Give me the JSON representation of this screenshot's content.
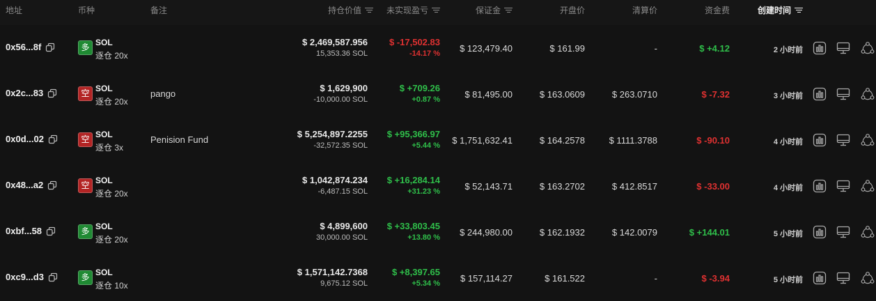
{
  "headers": {
    "address": "地址",
    "coin": "币种",
    "note": "备注",
    "position_value": "持仓价值",
    "unrealized_pnl": "未实现盈亏",
    "margin": "保证金",
    "entry_price": "开盘价",
    "liq_price": "清算价",
    "funding": "资金费",
    "created": "创建时间"
  },
  "colors": {
    "long": "#1f8a33",
    "short": "#b32424",
    "profit": "#2fbf4a",
    "loss": "#e03131"
  },
  "icons": [
    "copy-icon",
    "chart-bars-icon",
    "monitor-icon",
    "share-nodes-icon"
  ],
  "rows": [
    {
      "address": "0x56...8f",
      "side": "多",
      "side_type": "long",
      "coin": "SOL",
      "leverage": "逐仓 20x",
      "note": "",
      "value": "$ 2,469,587.956",
      "size": "15,353.36 SOL",
      "pnl": "$ -17,502.83",
      "pnl_pct": "-14.17 %",
      "pnl_dir": "loss",
      "margin": "$ 123,479.40",
      "entry": "$ 161.99",
      "liq": "-",
      "funding": "$ +4.12",
      "funding_dir": "profit",
      "created": "2 小时前"
    },
    {
      "address": "0x2c...83",
      "side": "空",
      "side_type": "short",
      "coin": "SOL",
      "leverage": "逐仓 20x",
      "note": "pango",
      "value": "$ 1,629,900",
      "size": "-10,000.00 SOL",
      "pnl": "$ +709.26",
      "pnl_pct": "+0.87 %",
      "pnl_dir": "profit",
      "margin": "$ 81,495.00",
      "entry": "$ 163.0609",
      "liq": "$ 263.0710",
      "funding": "$ -7.32",
      "funding_dir": "loss",
      "created": "3 小时前"
    },
    {
      "address": "0x0d...02",
      "side": "空",
      "side_type": "short",
      "coin": "SOL",
      "leverage": "逐仓 3x",
      "note": "Penision Fund",
      "value": "$ 5,254,897.2255",
      "size": "-32,572.35 SOL",
      "pnl": "$ +95,366.97",
      "pnl_pct": "+5.44 %",
      "pnl_dir": "profit",
      "margin": "$ 1,751,632.41",
      "entry": "$ 164.2578",
      "liq": "$ 1111.3788",
      "funding": "$ -90.10",
      "funding_dir": "loss",
      "created": "4 小时前"
    },
    {
      "address": "0x48...a2",
      "side": "空",
      "side_type": "short",
      "coin": "SOL",
      "leverage": "逐仓 20x",
      "note": "",
      "value": "$ 1,042,874.234",
      "size": "-6,487.15 SOL",
      "pnl": "$ +16,284.14",
      "pnl_pct": "+31.23 %",
      "pnl_dir": "profit",
      "margin": "$ 52,143.71",
      "entry": "$ 163.2702",
      "liq": "$ 412.8517",
      "funding": "$ -33.00",
      "funding_dir": "loss",
      "created": "4 小时前"
    },
    {
      "address": "0xbf...58",
      "side": "多",
      "side_type": "long",
      "coin": "SOL",
      "leverage": "逐仓 20x",
      "note": "",
      "value": "$ 4,899,600",
      "size": "30,000.00 SOL",
      "pnl": "$ +33,803.45",
      "pnl_pct": "+13.80 %",
      "pnl_dir": "profit",
      "margin": "$ 244,980.00",
      "entry": "$ 162.1932",
      "liq": "$ 142.0079",
      "funding": "$ +144.01",
      "funding_dir": "profit",
      "created": "5 小时前"
    },
    {
      "address": "0xc9...d3",
      "side": "多",
      "side_type": "long",
      "coin": "SOL",
      "leverage": "逐仓 10x",
      "note": "",
      "value": "$ 1,571,142.7368",
      "size": "9,675.12 SOL",
      "pnl": "$ +8,397.65",
      "pnl_pct": "+5.34 %",
      "pnl_dir": "profit",
      "margin": "$ 157,114.27",
      "entry": "$ 161.522",
      "liq": "-",
      "funding": "$ -3.94",
      "funding_dir": "loss",
      "created": "5 小时前"
    }
  ]
}
